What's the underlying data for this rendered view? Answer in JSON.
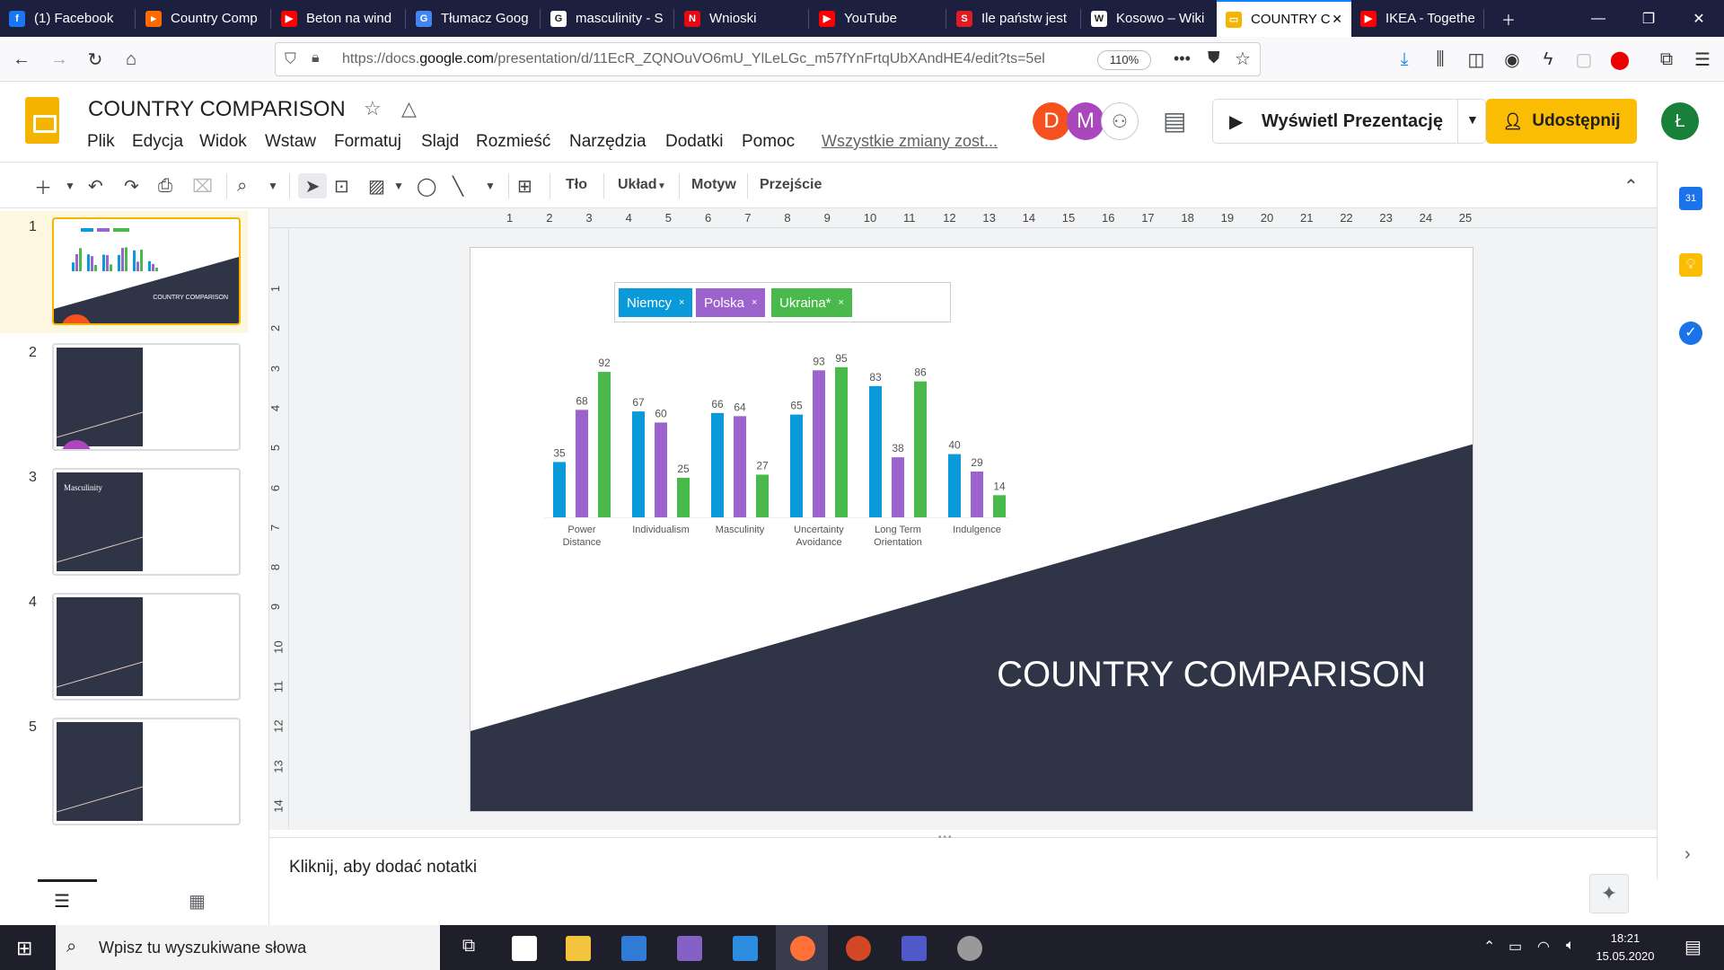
{
  "browser": {
    "tabs": [
      {
        "label": "(1) Facebook",
        "icon": "facebook-icon",
        "color": "#1877f2",
        "glyph": "f"
      },
      {
        "label": "Country Comp",
        "icon": "country-comp-icon",
        "color": "#ff6b00",
        "glyph": "▸"
      },
      {
        "label": "Beton na wind",
        "icon": "youtube-icon",
        "color": "#ff0000",
        "glyph": "▶"
      },
      {
        "label": "Tłumacz Goog",
        "icon": "google-translate-icon",
        "color": "#4285f4",
        "glyph": "G"
      },
      {
        "label": "masculinity - S",
        "icon": "google-icon",
        "color": "#ffffff",
        "glyph": "G"
      },
      {
        "label": "Wnioski",
        "icon": "netflix-icon",
        "color": "#e50914",
        "glyph": "N"
      },
      {
        "label": "YouTube",
        "icon": "youtube-icon",
        "color": "#ff0000",
        "glyph": "▶"
      },
      {
        "label": "Ile państw jest",
        "icon": "article-icon",
        "color": "#e01b24",
        "glyph": "S"
      },
      {
        "label": "Kosowo – Wiki",
        "icon": "wikipedia-icon",
        "color": "#ffffff",
        "glyph": "W"
      },
      {
        "label": "COUNTRY C",
        "icon": "google-slides-icon",
        "color": "#f4b400",
        "glyph": "▭"
      },
      {
        "label": "IKEA - Togethe",
        "icon": "youtube-icon",
        "color": "#ff0000",
        "glyph": "▶"
      }
    ],
    "url_prefix": "https://docs.",
    "url_host": "google.com",
    "url_rest": "/presentation/d/11EcR_ZQNOuVO6mU_YlLeLGc_m57fYnFrtqUbXAndHE4/edit?ts=5el",
    "zoom": "110%"
  },
  "docs": {
    "title": "COUNTRY COMPARISON",
    "menus": [
      "Plik",
      "Edycja",
      "Widok",
      "Wstaw",
      "Formatuj",
      "Slajd",
      "Rozmieść",
      "Narzędzia",
      "Dodatki",
      "Pomoc"
    ],
    "saved_status": "Wszystkie zmiany zost...",
    "collaborators": [
      "D",
      "M"
    ],
    "present_label": "Wyświetl Prezentację",
    "share_label": "Udostępnij",
    "user_initial": "Ł"
  },
  "toolbar": {
    "background_label": "Tło",
    "layout_label": "Układ",
    "theme_label": "Motyw",
    "transition_label": "Przejście"
  },
  "filmstrip": {
    "slides": [
      {
        "number": "1",
        "title": "COUNTRY COMPARISON"
      },
      {
        "number": "2",
        "title": ""
      },
      {
        "number": "3",
        "title": "Masculinity"
      },
      {
        "number": "4",
        "title": ""
      },
      {
        "number": "5",
        "title": ""
      }
    ]
  },
  "ruler": {
    "horizontal": [
      "1",
      "2",
      "3",
      "4",
      "5",
      "6",
      "7",
      "8",
      "9",
      "10",
      "11",
      "12",
      "13",
      "14",
      "15",
      "16",
      "17",
      "18",
      "19",
      "20",
      "21",
      "22",
      "23",
      "24",
      "25"
    ],
    "vertical": [
      "1",
      "2",
      "3",
      "4",
      "5",
      "6",
      "7",
      "8",
      "9",
      "10",
      "11",
      "12",
      "13",
      "14"
    ]
  },
  "slide": {
    "title": "COUNTRY COMPARISON",
    "dark_color": "#2f3447"
  },
  "chart_data": {
    "type": "bar",
    "categories": [
      "Power Distance",
      "Individualism",
      "Masculinity",
      "Uncertainty Avoidance",
      "Long Term Orientation",
      "Indulgence"
    ],
    "series": [
      {
        "name": "Niemcy",
        "color": "#0a9ad9",
        "values": [
          35,
          67,
          66,
          65,
          83,
          40
        ]
      },
      {
        "name": "Polska",
        "color": "#9c63cc",
        "values": [
          68,
          60,
          64,
          93,
          38,
          29
        ]
      },
      {
        "name": "Ukraina*",
        "color": "#48b94a",
        "values": [
          92,
          25,
          27,
          95,
          86,
          14
        ]
      }
    ],
    "ylim": [
      0,
      100
    ],
    "legend": "top",
    "grid": false
  },
  "notes": {
    "placeholder": "Kliknij, aby dodać notatki"
  },
  "taskbar": {
    "search_placeholder": "Wpisz tu wyszukiwane słowa",
    "time": "18:21",
    "date": "15.05.2020"
  }
}
